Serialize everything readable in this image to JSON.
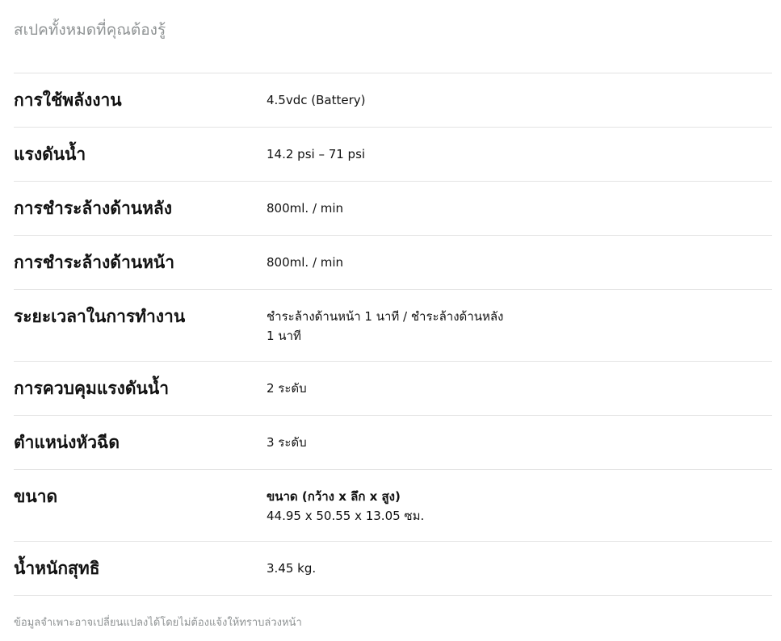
{
  "section_title": "สเปคทั้งหมดที่คุณต้องรู้",
  "specs": [
    {
      "label": "การใช้พลังงาน",
      "value": "4.5vdc (Battery)"
    },
    {
      "label": "แรงดันน้ำ",
      "value": "14.2 psi – 71 psi"
    },
    {
      "label": "การชำระล้างด้านหลัง",
      "value": "800ml. / min"
    },
    {
      "label": "การชำระล้างด้านหน้า",
      "value": "800ml. / min"
    },
    {
      "label": "ระยะเวลาในการทำงาน",
      "value_line1": "ชำระล้างด้านหน้า 1 นาที / ชำระล้างด้านหลัง",
      "value_line2": "1 นาที"
    },
    {
      "label": "การควบคุมแรงดันน้ำ",
      "value": "2 ระดับ"
    },
    {
      "label": "ตำแหน่งหัวฉีด",
      "value": "3 ระดับ"
    },
    {
      "label": "ขนาด",
      "value_heading": "ขนาด (กว้าง x ลึก x สูง)",
      "value": "44.95 x 50.55 x 13.05 ซม."
    },
    {
      "label": "น้ำหนักสุทธิ",
      "value": "3.45 kg."
    }
  ],
  "footnote": "ข้อมูลจำเพาะอาจเปลี่ยนแปลงได้โดยไม่ต้องแจ้งให้ทราบล่วงหน้า"
}
